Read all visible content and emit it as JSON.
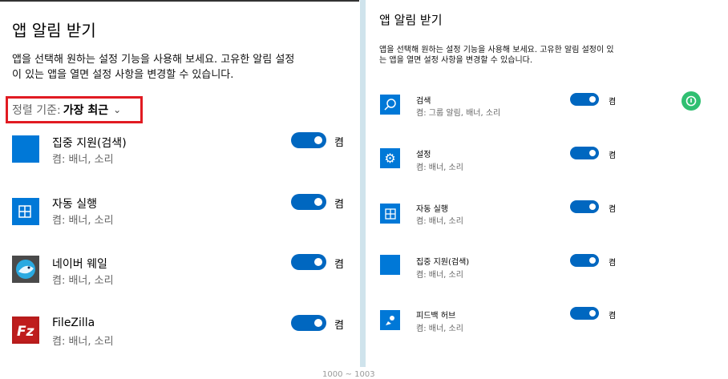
{
  "left": {
    "title": "앱 알림 받기",
    "description_line1": "앱을 선택해 원하는 설정 기능을 사용해 보세요. 고유한 알림 설정",
    "description_line2": "이 있는 앱을 열면 설정 사항을 변경할 수 있습니다.",
    "sort_label": "정렬 기준:",
    "sort_value": "가장 최근",
    "apps": [
      {
        "name": "집중 지원(검색)",
        "sub": "켬: 배너, 소리",
        "toggle": "켬",
        "icon": "blank-square-icon"
      },
      {
        "name": "자동 실행",
        "sub": "켬: 배너, 소리",
        "toggle": "켬",
        "icon": "autoplay-icon"
      },
      {
        "name": "네이버 웨일",
        "sub": "켬: 배너, 소리",
        "toggle": "켬",
        "icon": "naver-whale-icon"
      },
      {
        "name": "FileZilla",
        "sub": "켬: 배너, 소리",
        "toggle": "켬",
        "icon": "filezilla-icon"
      }
    ]
  },
  "right": {
    "title": "앱 알림 받기",
    "description_line1": "앱을 선택해 원하는 설정 기능을 사용해 보세요. 고유한 알림 설정이 있",
    "description_line2": "는 앱을 열면 설정 사항을 변경할 수 있습니다.",
    "apps": [
      {
        "name": "검색",
        "sub": "켬: 그룹 알림, 배너, 소리",
        "toggle": "켬",
        "icon": "search-icon"
      },
      {
        "name": "설정",
        "sub": "켬: 배너, 소리",
        "toggle": "켬",
        "icon": "gear-icon"
      },
      {
        "name": "자동 실행",
        "sub": "켬: 배너, 소리",
        "toggle": "켬",
        "icon": "autoplay-icon"
      },
      {
        "name": "집중 지원(검색)",
        "sub": "켬: 배너, 소리",
        "toggle": "켬",
        "icon": "blank-square-icon"
      },
      {
        "name": "피드백 허브",
        "sub": "켬: 배너, 소리",
        "toggle": "켬",
        "icon": "feedback-hub-icon"
      }
    ]
  },
  "footer_text": "1000 ~ 1003",
  "colors": {
    "accent": "#0067c0",
    "highlight_border": "#e11b22",
    "badge_green": "#2fbf71"
  }
}
